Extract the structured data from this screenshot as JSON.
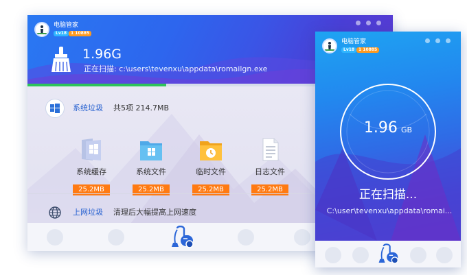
{
  "main": {
    "app_title": "电脑管家",
    "level_badge": "Lv18",
    "vip_badge": "1 10885",
    "size": "1.96G",
    "scan_label": "正在扫描:",
    "scan_path": "c:\\users\\tevenxu\\appdata\\romailgn.exe",
    "progress": 0.38,
    "section_system": {
      "title": "系统垃圾",
      "summary": "共5项 214.7MB",
      "items": [
        {
          "label": "系统缓存",
          "size": "25.2MB",
          "icon": "windows-folder-icon"
        },
        {
          "label": "系统文件",
          "size": "25.2MB",
          "icon": "windows-folder-icon"
        },
        {
          "label": "临时文件",
          "size": "25.2MB",
          "icon": "clock-folder-icon"
        },
        {
          "label": "日志文件",
          "size": "25.2MB",
          "icon": "document-icon"
        }
      ]
    },
    "section_web": {
      "title": "上网垃圾",
      "desc": "清理后大幅提高上网速度"
    }
  },
  "mini": {
    "app_title": "电脑管家",
    "level_badge": "Lv18",
    "vip_badge": "1 10885",
    "size_num": "1.96",
    "size_unit": "GB",
    "status": "正在扫描...",
    "scan_path": "C:\\user\\tevenxu\\appdata\\romai..."
  },
  "colors": {
    "accent_blue": "#2d66ee",
    "badge_orange": "#ff7a12",
    "progress_green": "#2ec45a"
  }
}
